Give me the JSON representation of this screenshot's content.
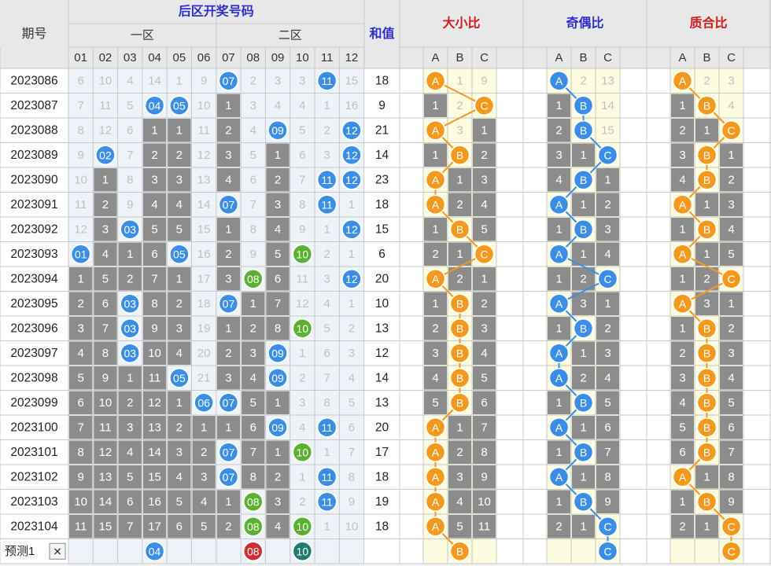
{
  "chart_data": {
    "type": "table",
    "header": {
      "period": "期号",
      "back_zone_title": "后区开奖号码",
      "zone1": "一区",
      "zone2": "二区",
      "sum": "和值",
      "size_ratio": "大小比",
      "odd_even_ratio": "奇偶比",
      "prime_ratio": "质合比",
      "abc": [
        "A",
        "B",
        "C"
      ],
      "numbers": [
        "01",
        "02",
        "03",
        "04",
        "05",
        "06",
        "07",
        "08",
        "09",
        "10",
        "11",
        "12"
      ]
    },
    "rows": [
      {
        "period": "2023086",
        "cells": [
          "6",
          "10",
          "4",
          "14",
          "1",
          "9",
          "07",
          "2",
          "3",
          "3",
          "11",
          "15"
        ],
        "sum": "18",
        "size": [
          "A",
          "1",
          "9"
        ],
        "odd_even": [
          "A",
          "2",
          "13"
        ],
        "prime": [
          "A",
          "2",
          "3"
        ]
      },
      {
        "period": "2023087",
        "cells": [
          "7",
          "11",
          "5",
          "04",
          "05",
          "10",
          "1",
          "3",
          "4",
          "4",
          "1",
          "16"
        ],
        "sum": "9",
        "size": [
          "1",
          "2",
          "C"
        ],
        "odd_even": [
          "1",
          "B",
          "14"
        ],
        "prime": [
          "1",
          "B",
          "4"
        ]
      },
      {
        "period": "2023088",
        "cells": [
          "8",
          "12",
          "6",
          "1",
          "1",
          "11",
          "2",
          "4",
          "09",
          "5",
          "2",
          "12"
        ],
        "sum": "21",
        "size": [
          "A",
          "3",
          "1"
        ],
        "odd_even": [
          "2",
          "B",
          "15"
        ],
        "prime": [
          "2",
          "1",
          "C"
        ]
      },
      {
        "period": "2023089",
        "cells": [
          "9",
          "02",
          "7",
          "2",
          "2",
          "12",
          "3",
          "5",
          "1",
          "6",
          "3",
          "12"
        ],
        "sum": "14",
        "size": [
          "1",
          "B",
          "2"
        ],
        "odd_even": [
          "3",
          "1",
          "C"
        ],
        "prime": [
          "3",
          "B",
          "1"
        ]
      },
      {
        "period": "2023090",
        "cells": [
          "10",
          "1",
          "8",
          "3",
          "3",
          "13",
          "4",
          "6",
          "2",
          "7",
          "11",
          "12"
        ],
        "sum": "23",
        "size": [
          "A",
          "1",
          "3"
        ],
        "odd_even": [
          "4",
          "B",
          "1"
        ],
        "prime": [
          "4",
          "B",
          "2"
        ]
      },
      {
        "period": "2023091",
        "cells": [
          "11",
          "2",
          "9",
          "4",
          "4",
          "14",
          "07",
          "7",
          "3",
          "8",
          "11",
          "1"
        ],
        "sum": "18",
        "size": [
          "A",
          "2",
          "4"
        ],
        "odd_even": [
          "A",
          "1",
          "2"
        ],
        "prime": [
          "A",
          "1",
          "3"
        ]
      },
      {
        "period": "2023092",
        "cells": [
          "12",
          "3",
          "03",
          "5",
          "5",
          "15",
          "1",
          "8",
          "4",
          "9",
          "1",
          "12"
        ],
        "sum": "15",
        "size": [
          "1",
          "B",
          "5"
        ],
        "odd_even": [
          "1",
          "B",
          "3"
        ],
        "prime": [
          "1",
          "B",
          "4"
        ]
      },
      {
        "period": "2023093",
        "cells": [
          "01",
          "4",
          "1",
          "6",
          "05",
          "16",
          "2",
          "9",
          "5",
          "10",
          "2",
          "1"
        ],
        "sum": "6",
        "size": [
          "2",
          "1",
          "C"
        ],
        "odd_even": [
          "A",
          "1",
          "4"
        ],
        "prime": [
          "A",
          "1",
          "5"
        ]
      },
      {
        "period": "2023094",
        "cells": [
          "1",
          "5",
          "2",
          "7",
          "1",
          "17",
          "3",
          "08",
          "6",
          "11",
          "3",
          "12"
        ],
        "sum": "20",
        "size": [
          "A",
          "2",
          "1"
        ],
        "odd_even": [
          "1",
          "2",
          "C"
        ],
        "prime": [
          "1",
          "2",
          "C"
        ]
      },
      {
        "period": "2023095",
        "cells": [
          "2",
          "6",
          "03",
          "8",
          "2",
          "18",
          "07",
          "1",
          "7",
          "12",
          "4",
          "1"
        ],
        "sum": "10",
        "size": [
          "1",
          "B",
          "2"
        ],
        "odd_even": [
          "A",
          "3",
          "1"
        ],
        "prime": [
          "A",
          "3",
          "1"
        ]
      },
      {
        "period": "2023096",
        "cells": [
          "3",
          "7",
          "03",
          "9",
          "3",
          "19",
          "1",
          "2",
          "8",
          "10",
          "5",
          "2"
        ],
        "sum": "13",
        "size": [
          "2",
          "B",
          "3"
        ],
        "odd_even": [
          "1",
          "B",
          "2"
        ],
        "prime": [
          "1",
          "B",
          "2"
        ]
      },
      {
        "period": "2023097",
        "cells": [
          "4",
          "8",
          "03",
          "10",
          "4",
          "20",
          "2",
          "3",
          "09",
          "1",
          "6",
          "3"
        ],
        "sum": "12",
        "size": [
          "3",
          "B",
          "4"
        ],
        "odd_even": [
          "A",
          "1",
          "3"
        ],
        "prime": [
          "2",
          "B",
          "3"
        ]
      },
      {
        "period": "2023098",
        "cells": [
          "5",
          "9",
          "1",
          "11",
          "05",
          "21",
          "3",
          "4",
          "09",
          "2",
          "7",
          "4"
        ],
        "sum": "14",
        "size": [
          "4",
          "B",
          "5"
        ],
        "odd_even": [
          "A",
          "2",
          "4"
        ],
        "prime": [
          "3",
          "B",
          "4"
        ]
      },
      {
        "period": "2023099",
        "cells": [
          "6",
          "10",
          "2",
          "12",
          "1",
          "06",
          "07",
          "5",
          "1",
          "3",
          "8",
          "5"
        ],
        "sum": "13",
        "size": [
          "5",
          "B",
          "6"
        ],
        "odd_even": [
          "1",
          "B",
          "5"
        ],
        "prime": [
          "4",
          "B",
          "5"
        ]
      },
      {
        "period": "2023100",
        "cells": [
          "7",
          "11",
          "3",
          "13",
          "2",
          "1",
          "1",
          "6",
          "09",
          "4",
          "11",
          "6"
        ],
        "sum": "20",
        "size": [
          "A",
          "1",
          "7"
        ],
        "odd_even": [
          "A",
          "1",
          "6"
        ],
        "prime": [
          "5",
          "B",
          "6"
        ]
      },
      {
        "period": "2023101",
        "cells": [
          "8",
          "12",
          "4",
          "14",
          "3",
          "2",
          "07",
          "7",
          "1",
          "10",
          "1",
          "7"
        ],
        "sum": "17",
        "size": [
          "A",
          "2",
          "8"
        ],
        "odd_even": [
          "1",
          "B",
          "7"
        ],
        "prime": [
          "6",
          "B",
          "7"
        ]
      },
      {
        "period": "2023102",
        "cells": [
          "9",
          "13",
          "5",
          "15",
          "4",
          "3",
          "07",
          "8",
          "2",
          "1",
          "11",
          "8"
        ],
        "sum": "18",
        "size": [
          "A",
          "3",
          "9"
        ],
        "odd_even": [
          "A",
          "1",
          "8"
        ],
        "prime": [
          "A",
          "1",
          "8"
        ]
      },
      {
        "period": "2023103",
        "cells": [
          "10",
          "14",
          "6",
          "16",
          "5",
          "4",
          "1",
          "08",
          "3",
          "2",
          "11",
          "9"
        ],
        "sum": "19",
        "size": [
          "A",
          "4",
          "10"
        ],
        "odd_even": [
          "1",
          "B",
          "9"
        ],
        "prime": [
          "1",
          "B",
          "9"
        ]
      },
      {
        "period": "2023104",
        "cells": [
          "11",
          "15",
          "7",
          "17",
          "6",
          "5",
          "2",
          "08",
          "4",
          "10",
          "1",
          "10"
        ],
        "sum": "18",
        "size": [
          "A",
          "5",
          "11"
        ],
        "odd_even": [
          "2",
          "1",
          "C"
        ],
        "prime": [
          "2",
          "1",
          "C"
        ]
      }
    ],
    "forecast": {
      "label": "预测1",
      "close": "✕",
      "numbers": [
        {
          "col": 4,
          "text": "04"
        },
        {
          "col": 8,
          "text": "08"
        },
        {
          "col": 10,
          "text": "10"
        }
      ],
      "size": "B",
      "odd_even": "C",
      "prime": "C"
    }
  },
  "colors": {
    "header_bg": "#e8e8e8",
    "grid": "#c8c8c8",
    "miss_text": "#c0c0c0",
    "zone_bg": "#eef3f9",
    "gray_bar": "#8c8c8c",
    "blue_ball": "#3a8ee6",
    "orange_ball": "#f39a1e",
    "title_blue": "#2e2ecc",
    "title_red": "#d41a1a",
    "ratio_bg": "#fdfce0"
  }
}
